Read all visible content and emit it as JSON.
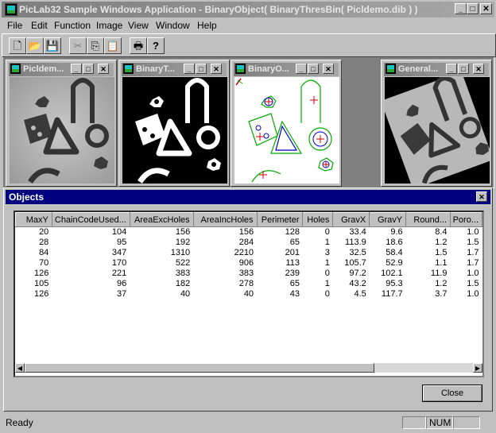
{
  "window": {
    "title": "PicLab32 Sample Windows Application - BinaryObject( BinaryThresBin( Picldemo.dib ) )",
    "min": "_",
    "max": "□",
    "close": "✕"
  },
  "menu": [
    "File",
    "Edit",
    "Function",
    "Image",
    "View",
    "Window",
    "Help"
  ],
  "toolbar": {
    "new_icon": "new-file-icon",
    "open_icon": "open-folder-icon",
    "save_icon": "save-disk-icon",
    "cut_icon": "scissors-icon",
    "copy_icon": "copy-icon",
    "paste_icon": "paste-icon",
    "print_icon": "printer-icon",
    "help_icon": "help-icon",
    "glyphs": {
      "new": "🗋",
      "open": "📂",
      "save": "💾",
      "cut": "✂",
      "copy": "⎘",
      "paste": "📋",
      "print": "🖶",
      "help": "?"
    }
  },
  "children": [
    {
      "title": "Picldem..."
    },
    {
      "title": "BinaryT..."
    },
    {
      "title": "BinaryO..."
    },
    {
      "title": "General..."
    }
  ],
  "objects": {
    "title": "Objects",
    "close_glyph": "✕",
    "columns": [
      "MaxY",
      "ChainCodeUsed...",
      "AreaExcHoles",
      "AreaIncHoles",
      "Perimeter",
      "Holes",
      "GravX",
      "GravY",
      "Round...",
      "Poro..."
    ],
    "rows": [
      [
        "20",
        "104",
        "156",
        "156",
        "128",
        "0",
        "33.4",
        "9.6",
        "8.4",
        "1.0"
      ],
      [
        "28",
        "95",
        "192",
        "284",
        "65",
        "1",
        "113.9",
        "18.6",
        "1.2",
        "1.5"
      ],
      [
        "84",
        "347",
        "1310",
        "2210",
        "201",
        "3",
        "32.5",
        "58.4",
        "1.5",
        "1.7"
      ],
      [
        "70",
        "170",
        "522",
        "906",
        "113",
        "1",
        "105.7",
        "52.9",
        "1.1",
        "1.7"
      ],
      [
        "126",
        "221",
        "383",
        "383",
        "239",
        "0",
        "97.2",
        "102.1",
        "11.9",
        "1.0"
      ],
      [
        "105",
        "96",
        "182",
        "278",
        "65",
        "1",
        "43.2",
        "95.3",
        "1.2",
        "1.5"
      ],
      [
        "126",
        "37",
        "40",
        "40",
        "43",
        "0",
        "4.5",
        "117.7",
        "3.7",
        "1.0"
      ]
    ],
    "close_button": "Close"
  },
  "status": {
    "text": "Ready",
    "num": "NUM"
  },
  "colors": {
    "active_caption": "#000080",
    "inactive_caption": "#808080",
    "face": "#c0c0c0"
  }
}
